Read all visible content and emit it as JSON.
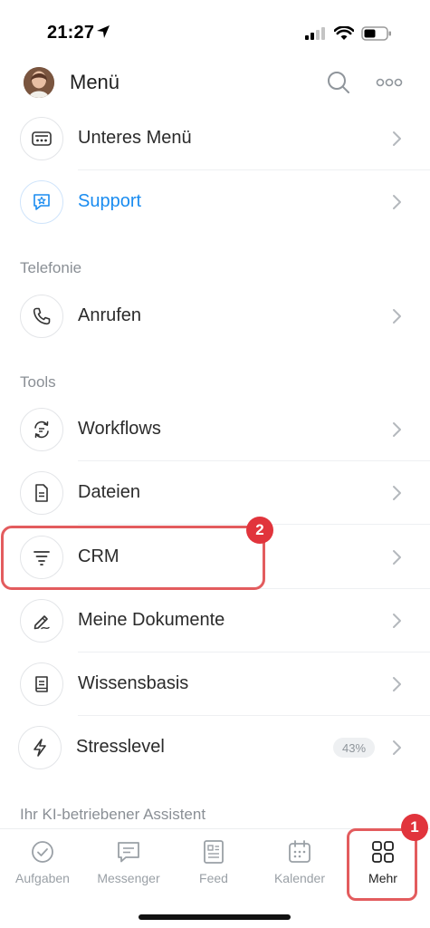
{
  "status": {
    "time": "21:27"
  },
  "header": {
    "title": "Menü"
  },
  "rows": {
    "unteres_menu": "Unteres Menü",
    "support": "Support",
    "anrufen": "Anrufen",
    "workflows": "Workflows",
    "dateien": "Dateien",
    "crm": "CRM",
    "dokumente": "Meine Dokumente",
    "wissensbasis": "Wissensbasis",
    "stresslevel": "Stresslevel",
    "stresslevel_value": "43%"
  },
  "sections": {
    "telefonie": "Telefonie",
    "tools": "Tools",
    "ki": "Ihr KI-betriebener Assistent"
  },
  "badges": {
    "crm": "2",
    "mehr": "1"
  },
  "tabs": {
    "aufgaben": "Aufgaben",
    "messenger": "Messenger",
    "feed": "Feed",
    "kalender": "Kalender",
    "mehr": "Mehr"
  },
  "colors": {
    "accent": "#1a8cf0",
    "highlight": "#e35c5e",
    "badge": "#e1343c"
  },
  "icons": {
    "unteres_menu": "bottom-menu-icon",
    "support": "support-star-icon",
    "anrufen": "phone-icon",
    "workflows": "workflow-icon",
    "dateien": "file-icon",
    "crm": "crm-funnel-icon",
    "dokumente": "pen-icon",
    "wissensbasis": "book-icon",
    "stresslevel": "lightning-icon"
  }
}
